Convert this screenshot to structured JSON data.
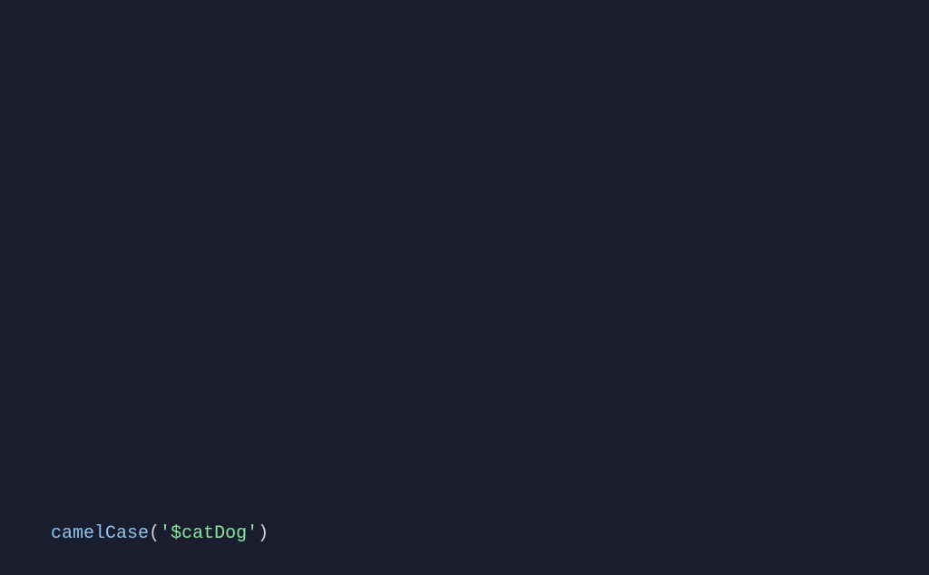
{
  "code": {
    "functionName": "camelCase",
    "openParen": "(",
    "quoteOpen": "'",
    "stringContent": "$catDog",
    "quoteClose": "'",
    "closeParen": ")"
  }
}
